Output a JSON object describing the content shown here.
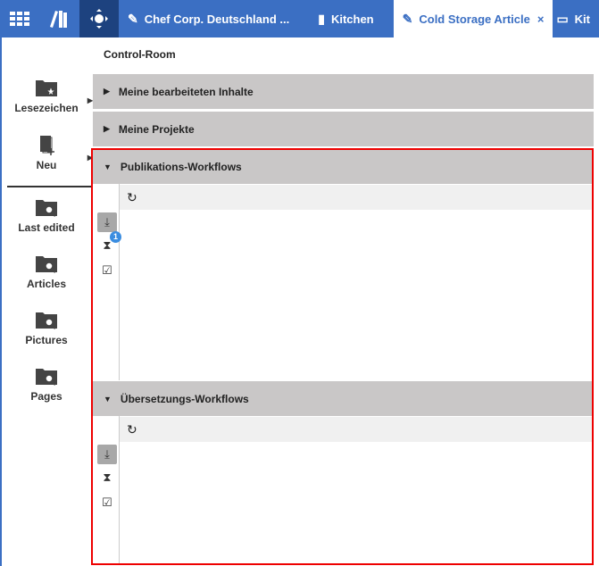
{
  "topbar": {
    "icons": [
      {
        "name": "apps-grid-icon"
      },
      {
        "name": "library-icon"
      },
      {
        "name": "control-room-icon",
        "active": true
      }
    ],
    "tabs": [
      {
        "label": "Chef Corp. Deutschland ...",
        "icon": "pencil-icon"
      },
      {
        "label": "Kitchen",
        "icon": "page-icon"
      },
      {
        "label": "Cold Storage Article",
        "icon": "pencil-icon",
        "active": true,
        "close": "×"
      },
      {
        "label": "Kit",
        "icon": "window-icon"
      }
    ]
  },
  "sidebar": {
    "items": [
      {
        "label": "Lesezeichen",
        "icon": "folder-star-icon"
      },
      {
        "label": "Neu",
        "icon": "new-document-icon"
      },
      {
        "label": "Last edited",
        "icon": "folder-search-icon"
      },
      {
        "label": "Articles",
        "icon": "folder-search-icon"
      },
      {
        "label": "Pictures",
        "icon": "folder-search-icon"
      },
      {
        "label": "Pages",
        "icon": "folder-search-icon"
      }
    ]
  },
  "main": {
    "title": "Control-Room",
    "sections": [
      {
        "label": "Meine bearbeiteten Inhalte",
        "expanded": false
      },
      {
        "label": "Meine Projekte",
        "expanded": false
      },
      {
        "label": "Publikations-Workflows",
        "expanded": true,
        "pending_badge": "1"
      },
      {
        "label": "Übersetzungs-Workflows",
        "expanded": true
      }
    ]
  },
  "colors": {
    "accent": "#3b6fc3",
    "active_nav": "#1d427f",
    "section_bg": "#c9c7c7",
    "highlight_border": "#e00000"
  }
}
